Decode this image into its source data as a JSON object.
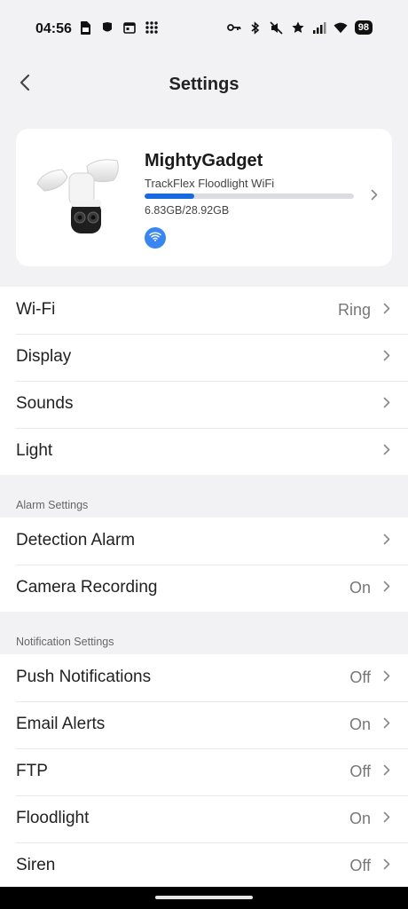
{
  "status_bar": {
    "time": "04:56",
    "battery": "98",
    "left_icons": [
      "sim-card-icon",
      "mask-icon",
      "calendar-icon",
      "apps-grid-icon"
    ],
    "right_icons": [
      "vpn-key-icon",
      "bluetooth-icon",
      "mute-icon",
      "star-icon",
      "signal-icon",
      "wifi-icon"
    ]
  },
  "header": {
    "title": "Settings",
    "back_icon": "chevron-left-icon"
  },
  "device": {
    "name": "MightyGadget",
    "model": "TrackFlex Floodlight WiFi",
    "storage_text": "6.83GB/28.92GB",
    "storage_used_fraction": 0.236,
    "accent_color": "#1769e0"
  },
  "groups": {
    "general": [
      {
        "label": "Wi-Fi",
        "value": "Ring"
      },
      {
        "label": "Display",
        "value": ""
      },
      {
        "label": "Sounds",
        "value": ""
      },
      {
        "label": "Light",
        "value": ""
      }
    ],
    "alarm": {
      "title": "Alarm Settings",
      "items": [
        {
          "label": "Detection Alarm",
          "value": ""
        },
        {
          "label": "Camera Recording",
          "value": "On"
        }
      ]
    },
    "notification": {
      "title": "Notification Settings",
      "items": [
        {
          "label": "Push Notifications",
          "value": "Off"
        },
        {
          "label": "Email Alerts",
          "value": "On"
        },
        {
          "label": "FTP",
          "value": "Off"
        },
        {
          "label": "Floodlight",
          "value": "On"
        },
        {
          "label": "Siren",
          "value": "Off"
        }
      ]
    }
  }
}
